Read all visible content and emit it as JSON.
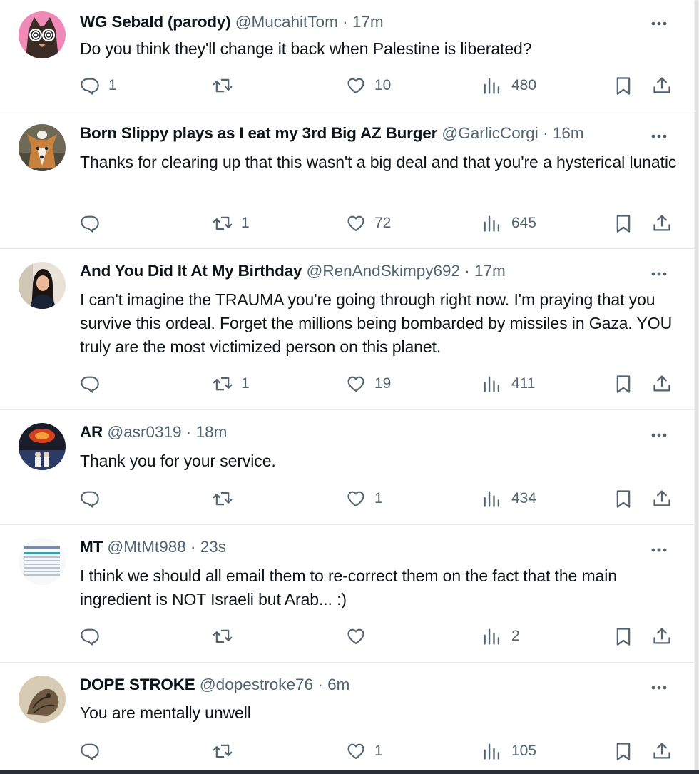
{
  "tweets": [
    {
      "name": "WG Sebald (parody)",
      "handle": "@MucahitTom",
      "dot": "·",
      "time": "17m",
      "text": "Do you think they'll change it back when Palestine is liberated?",
      "replies": "1",
      "retweets": "",
      "likes": "10",
      "views": "480",
      "avatar": "cat-avatar"
    },
    {
      "name": "Born Slippy plays as I eat my 3rd Big AZ Burger",
      "handle": "@GarlicCorgi",
      "dot": "·",
      "time": "16m",
      "text": "Thanks for clearing up that this wasn't a big deal and that you're a hysterical lunatic",
      "replies": "",
      "retweets": "1",
      "likes": "72",
      "views": "645",
      "avatar": "corgi-avatar"
    },
    {
      "name": "And You Did It At My Birthday",
      "handle": "@RenAndSkimpy692",
      "dot": "·",
      "time": "17m",
      "text": "I can't imagine the TRAUMA you're going through right now. I'm praying that you survive this ordeal. Forget the millions being bombarded by missiles in Gaza. YOU truly are the most victimized person on this planet.",
      "replies": "",
      "retweets": "1",
      "likes": "19",
      "views": "411",
      "avatar": "woman-avatar"
    },
    {
      "name": "AR",
      "handle": "@asr0319",
      "dot": "·",
      "time": "18m",
      "text": "Thank you for your service.",
      "replies": "",
      "retweets": "",
      "likes": "1",
      "views": "434",
      "avatar": "fire-avatar"
    },
    {
      "name": "MT",
      "handle": "@MtMt988",
      "dot": "·",
      "time": "23s",
      "text": "I think we should all email them to re-correct them on the fact that the main ingredient is NOT Israeli but Arab... :)",
      "replies": "",
      "retweets": "",
      "likes": "",
      "views": "2",
      "avatar": "table-avatar"
    },
    {
      "name": "DOPE STROKE",
      "handle": "@dopestroke76",
      "dot": "·",
      "time": "6m",
      "text": "You are mentally unwell",
      "replies": "",
      "retweets": "",
      "likes": "1",
      "views": "105",
      "avatar": "sketch-avatar"
    }
  ],
  "icons": {
    "reply": "reply-icon",
    "retweet": "retweet-icon",
    "like": "heart-icon",
    "views": "views-icon",
    "bookmark": "bookmark-icon",
    "share": "share-icon",
    "more": "more-icon"
  },
  "colors": {
    "text": "#0f1419",
    "secondary": "#536471",
    "divider": "#e6e9eb"
  }
}
